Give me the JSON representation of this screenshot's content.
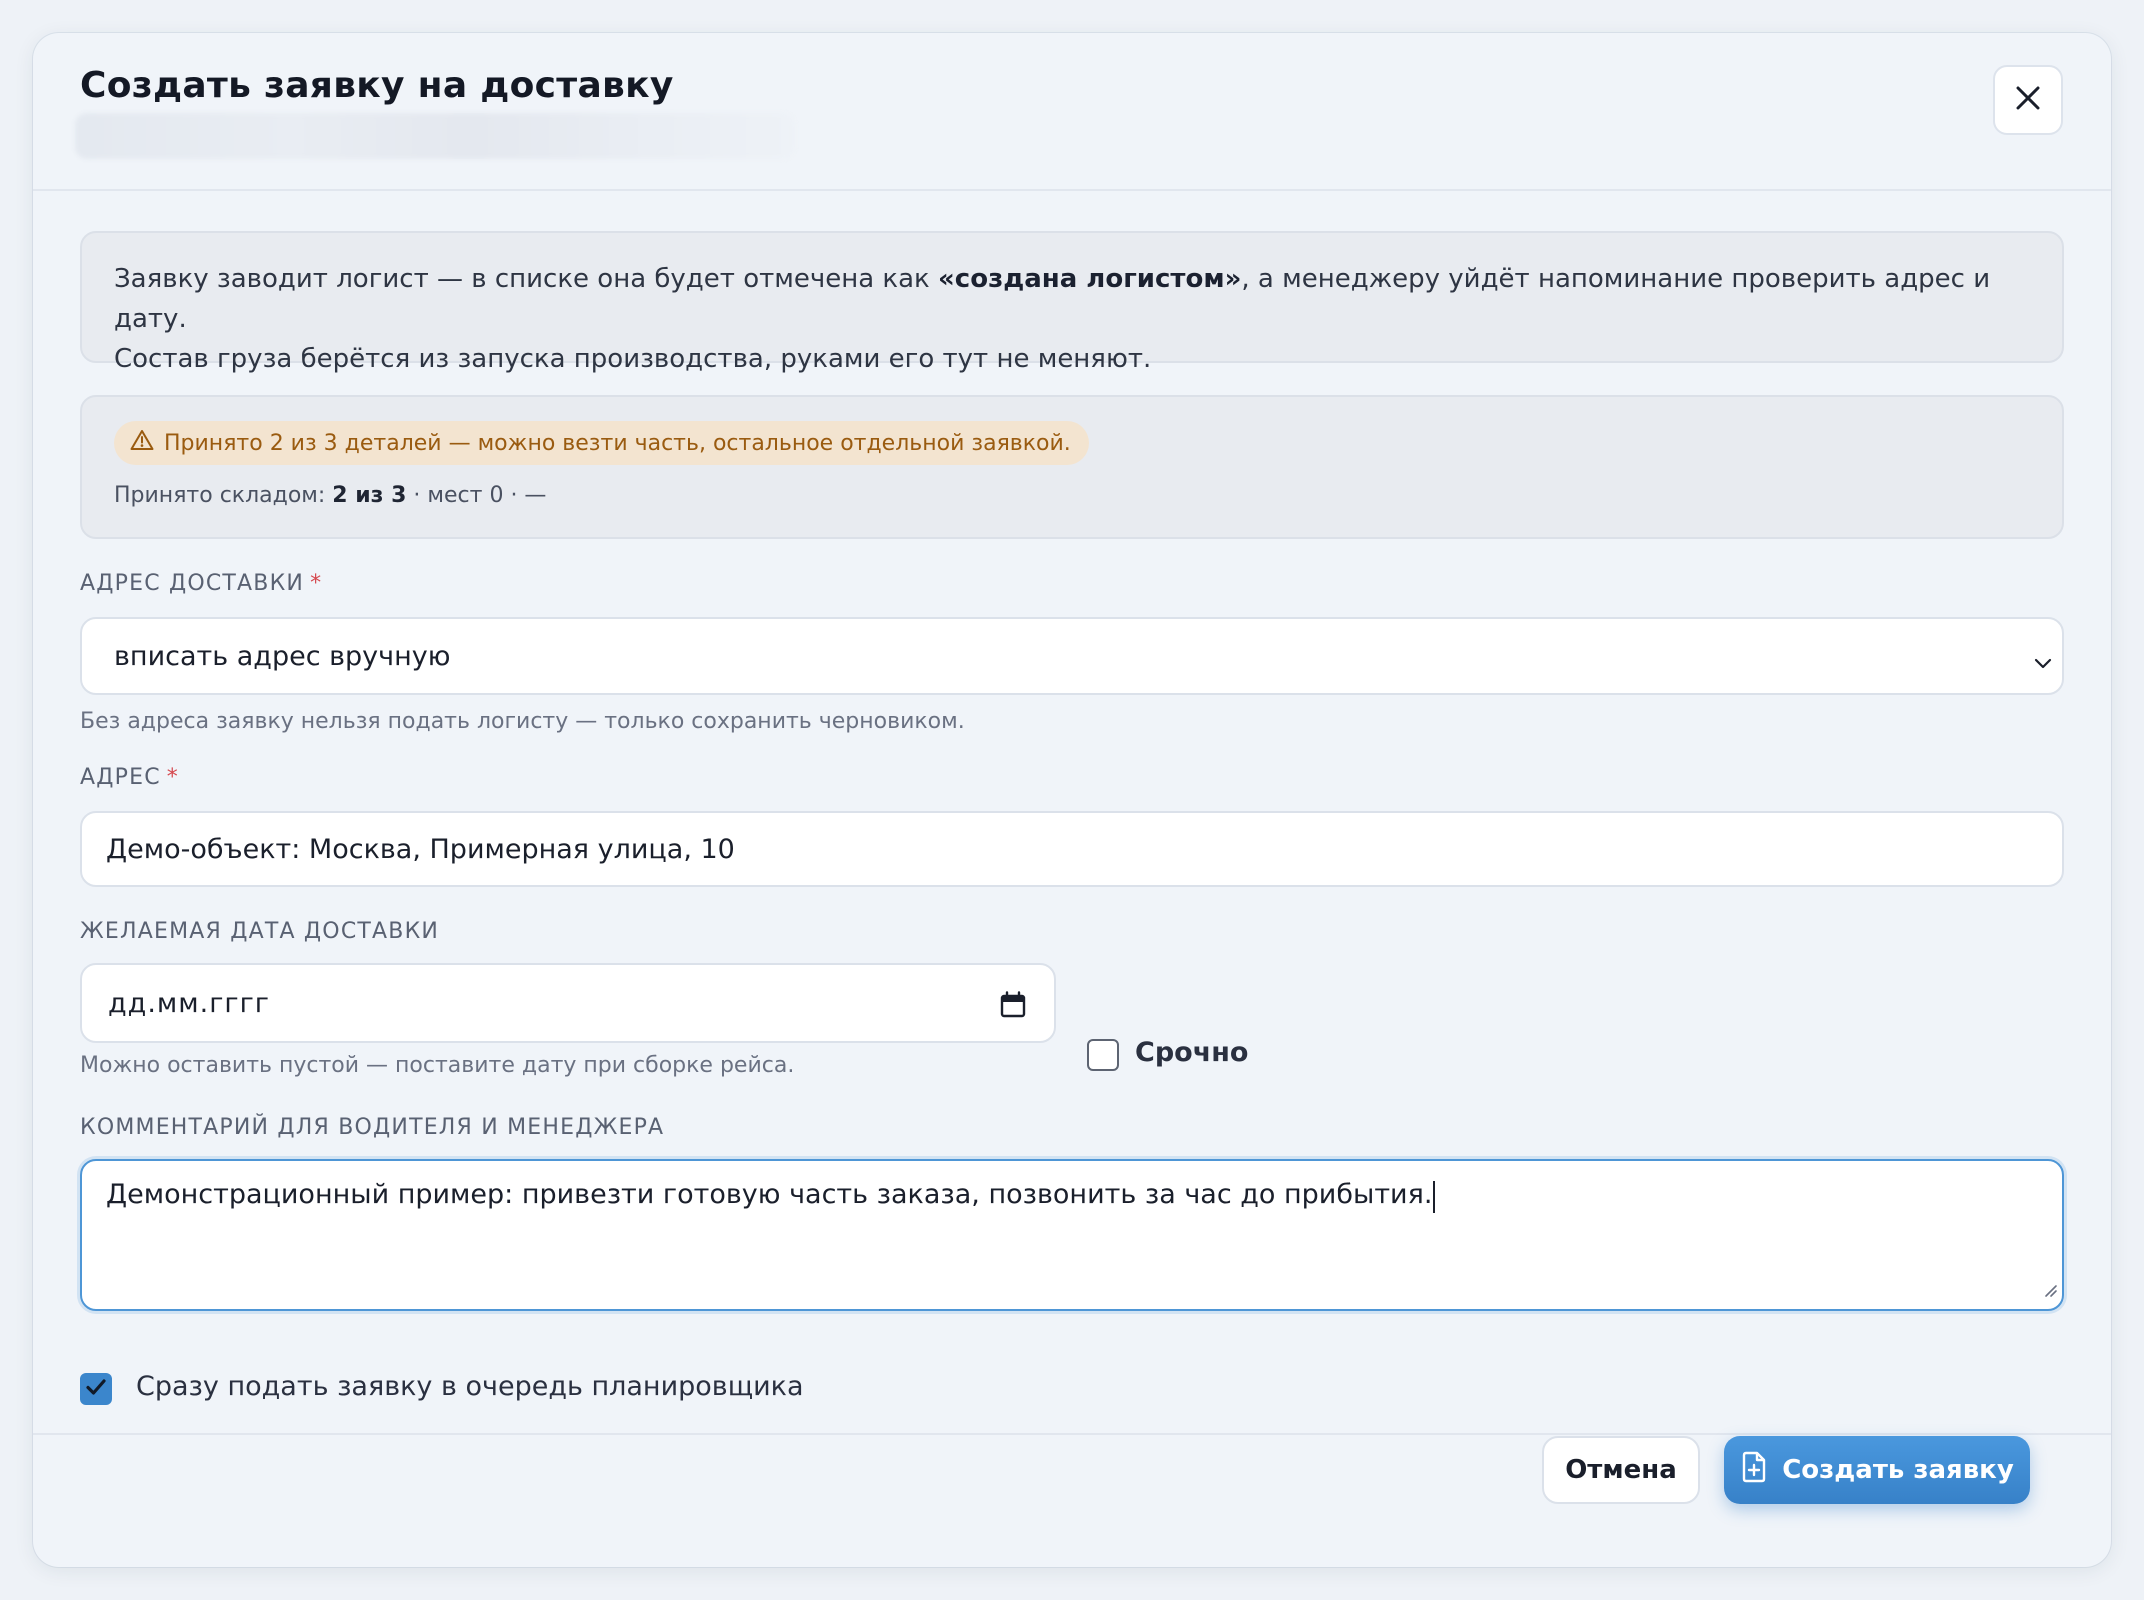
{
  "dialog": {
    "title": "Создать заявку на доставку",
    "close_icon": "close-icon"
  },
  "info": {
    "part1": "Заявку заводит логист — в списке она будет отмечена как ",
    "bold": "«создана логистом»",
    "part2": ", а менеджеру уйдёт напоминание проверить адрес и дату.",
    "line2": "Состав груза берётся из запуска производства, руками его тут не меняют."
  },
  "status": {
    "warning_icon": "warning-triangle-icon",
    "warning_text": "Принято 2 из 3 деталей — можно везти часть, остальное отдельной заявкой.",
    "received_prefix": "Принято складом: ",
    "received_value": "2 из 3",
    "received_suffix": " · мест 0 · —"
  },
  "delivery_address": {
    "label": "АДРЕС ДОСТАВКИ",
    "required_mark": "*",
    "selected": "вписать адрес вручную",
    "hint": "Без адреса заявку нельзя подать логисту — только сохранить черновиком."
  },
  "address": {
    "label": "АДРЕС",
    "required_mark": "*",
    "value": "Демо-объект: Москва, Примерная улица, 10"
  },
  "date": {
    "label": "ЖЕЛАЕМАЯ ДАТА ДОСТАВКИ",
    "placeholder": "дд.мм.гггг",
    "hint": "Можно оставить пустой — поставите дату при сборке рейса.",
    "calendar_icon": "calendar-icon"
  },
  "urgent": {
    "label": "Срочно",
    "checked": false
  },
  "comment": {
    "label": "КОММЕНТАРИЙ ДЛЯ ВОДИТЕЛЯ И МЕНЕДЖЕРА",
    "value": "Демонстрационный пример: привезти готовую часть заказа, позвонить за час до прибытия."
  },
  "queue": {
    "label": "Сразу подать заявку в очередь планировщика",
    "checked": true
  },
  "footer": {
    "cancel_label": "Отмена",
    "submit_label": "Создать заявку",
    "submit_icon": "file-plus-icon"
  },
  "colors": {
    "accent": "#3b86cc",
    "warning_text": "#9a5b10",
    "warning_bg": "#f3e4d0",
    "required": "#d5494f"
  }
}
